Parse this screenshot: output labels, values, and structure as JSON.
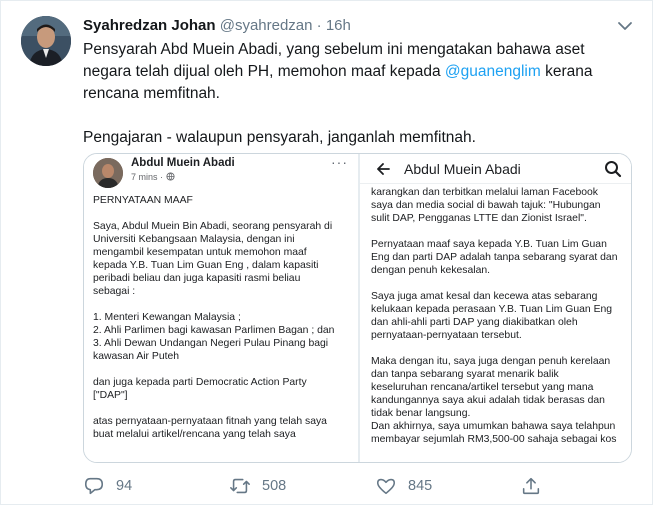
{
  "tweet": {
    "display_name": "Syahredzan Johan",
    "handle": "@syahredzan",
    "separator": "·",
    "time": "16h",
    "text_part1": "Pensyarah Abd Muein Abadi, yang sebelum ini mengatakan bahawa aset negara telah dijual oleh PH, memohon maaf kepada ",
    "mention": "@guanenglim",
    "text_part2": " kerana rencana memfitnah.",
    "text_para2": "Pengajaran - walaupun pensyarah, janganlah memfitnah.",
    "icons": {
      "avatar": "profile-photo",
      "caret": "chevron-down-icon"
    }
  },
  "image_left": {
    "author": "Abdul Muein Abadi",
    "meta": "7 mins · ",
    "more": "···",
    "lines": [
      "PERNYATAAN MAAF",
      "",
      "Saya, Abdul Muein Bin Abadi, seorang pensyarah di",
      "Universiti Kebangsaan Malaysia, dengan ini",
      "mengambil kesempatan untuk memohon maaf",
      "kepada Y.B. Tuan Lim Guan Eng , dalam kapasiti",
      "peribadi beliau dan juga kapasiti rasmi beliau",
      "sebagai :",
      "",
      "1. Menteri Kewangan Malaysia ;",
      "2. Ahli Parlimen bagi kawasan Parlimen Bagan ; dan",
      "3. Ahli Dewan Undangan Negeri Pulau Pinang bagi",
      "kawasan Air Puteh",
      "",
      "dan juga kepada parti Democratic Action Party",
      "[\"DAP\"]",
      "",
      "atas pernyataan-pernyataan fitnah yang telah saya",
      "buat melalui artikel/rencana yang telah saya"
    ]
  },
  "image_right": {
    "title": "Abdul Muein Abadi",
    "icons": {
      "back": "back-arrow-icon",
      "search": "search-icon"
    },
    "lines": [
      "karangkan dan terbitkan melalui laman Facebook",
      "saya dan media social di bawah tajuk: \"Hubungan",
      "sulit DAP, Pengganas LTTE dan Zionist Israel\".",
      "",
      "Pernyataan maaf saya kepada Y.B. Tuan Lim Guan",
      "Eng dan parti DAP adalah tanpa sebarang syarat dan",
      "dengan penuh kekesalan.",
      "",
      "Saya juga amat kesal dan kecewa atas sebarang",
      "kelukaan kepada perasaan Y.B. Tuan Lim Guan Eng",
      "dan ahli-ahli parti DAP yang diakibatkan oleh",
      "pernyataan-pernyataan tersebut.",
      "",
      "Maka dengan itu, saya juga dengan penuh kerelaan",
      "dan tanpa sebarang syarat menarik balik",
      "keseluruhan rencana/artikel tersebut yang mana",
      "kandungannya saya akui adalah tidak berasas dan",
      "tidak benar langsung.",
      "Dan akhirnya, saya umumkan bahawa saya telahpun",
      "membayar sejumlah RM3,500-00 sahaja sebagai kos"
    ]
  },
  "actions": {
    "reply_count": "94",
    "retweet_count": "508",
    "like_count": "845",
    "icons": [
      "reply-icon",
      "retweet-icon",
      "like-icon",
      "share-icon"
    ]
  },
  "colors": {
    "accent": "#1da1f2",
    "muted": "#657786",
    "text": "#14171a"
  }
}
